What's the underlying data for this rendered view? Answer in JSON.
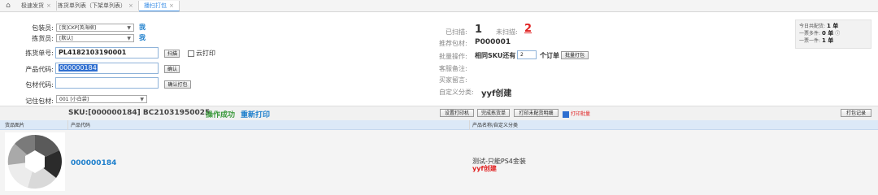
{
  "tabs": [
    {
      "label": "极速发货",
      "close": "×"
    },
    {
      "label": "拣货单列表（下架单列表）",
      "close": "×"
    },
    {
      "label": "播扫打包",
      "close": "×"
    }
  ],
  "form": {
    "packer_label": "包装员:",
    "packer_value": "[我]CKP[英海柳]",
    "packer_me": "我",
    "picker_label": "拣货员:",
    "picker_value": "[默认]",
    "picker_me": "我",
    "pick_no_label": "拣货单号:",
    "pick_no_value": "PL4182103190001",
    "scan_button": "扫描",
    "cloud_print_label": "云打印",
    "product_code_label": "产品代码:",
    "product_code_value": "000000184",
    "enter_button": "确认",
    "material_code_label": "包材代码:",
    "material_code_value": "",
    "confirm_pack_button": "确认打包",
    "remember_material_label": "记住包材:",
    "remember_material_value": "001 [小白袋]"
  },
  "info": {
    "scanned_label": "已扫描:",
    "scanned_value": "1",
    "unscanned_label": "未扫描:",
    "unscanned_value": "2",
    "recommend_label": "推荐包材:",
    "recommend_value": "P000001",
    "batch_label": "批量操作:",
    "batch_text_1": "相同SKU还有",
    "batch_qty": "2",
    "batch_text_2": "个订单",
    "batch_button": "批量打包",
    "cs_note_label": "客服备注:",
    "buyer_msg_label": "买家留言:",
    "custom_cat_label": "自定义分类:",
    "custom_cat_value": "yyf创建"
  },
  "stats": {
    "line1_label": "今日共配货:",
    "line1_value": "1 单",
    "line2_label": "一票多件:",
    "line2_value": "0 单",
    "line3_label": "一票一件:",
    "line3_value": "1 单"
  },
  "skubar": {
    "sku_text": "SKU:[000000184]  BC21031950025",
    "status": "操作成功",
    "reprint": "重新打印",
    "btn_printer": "设置打印机",
    "btn_finish": "完成拣货单",
    "btn_print_list": "打印未配货明细",
    "print_recent": "打印批量",
    "btn_pack_log": "打包记录"
  },
  "table": {
    "headers": [
      "货品图片",
      "产品代码",
      "产品名称/自定义分类"
    ],
    "row": {
      "code": "000000184",
      "name": "测试-只能PS4金装",
      "category": "yyf创建"
    }
  },
  "colors": {
    "accent": "#1e7fcc",
    "danger": "#e02020",
    "header_bg": "#dce9f7"
  }
}
